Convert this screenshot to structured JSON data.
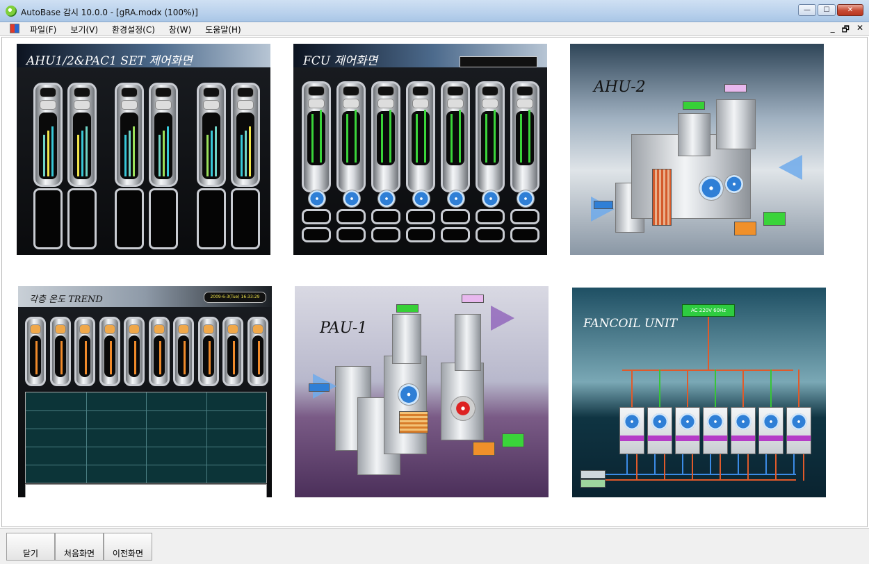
{
  "window": {
    "title": "AutoBase 감시 10.0.0 - [gRA.modx (100%)]",
    "minimize_glyph": "—",
    "maximize_glyph": "☐",
    "close_glyph": "✕"
  },
  "menu": {
    "items": [
      "파일(F)",
      "보기(V)",
      "환경설정(C)",
      "창(W)",
      "도움말(H)"
    ],
    "mdi_minimize": "_",
    "mdi_restore": "🗗",
    "mdi_close": "✕"
  },
  "thumbnails": {
    "ahu_pac": {
      "title": "AHU1/2&PAC1 SET 제어화면"
    },
    "fcu": {
      "title": "FCU 제어화면"
    },
    "ahu2": {
      "title": "AHU-2"
    },
    "trend": {
      "title": "각층 온도 TREND",
      "datetime": "2009-6-3(Tue)  16:33:29"
    },
    "pau1": {
      "title": "PAU-1"
    },
    "fancoil": {
      "title": "FANCOIL UNIT",
      "power_label": "AC 220V 60Hz"
    }
  },
  "buttons": {
    "close": "닫기",
    "home": "처음화면",
    "previous": "이전화면"
  },
  "colors": {
    "accent_green": "#2ecc40",
    "accent_yellow": "#f1e54a",
    "accent_cyan": "#38c8d8",
    "fcu_purple": "#b53bc7"
  }
}
